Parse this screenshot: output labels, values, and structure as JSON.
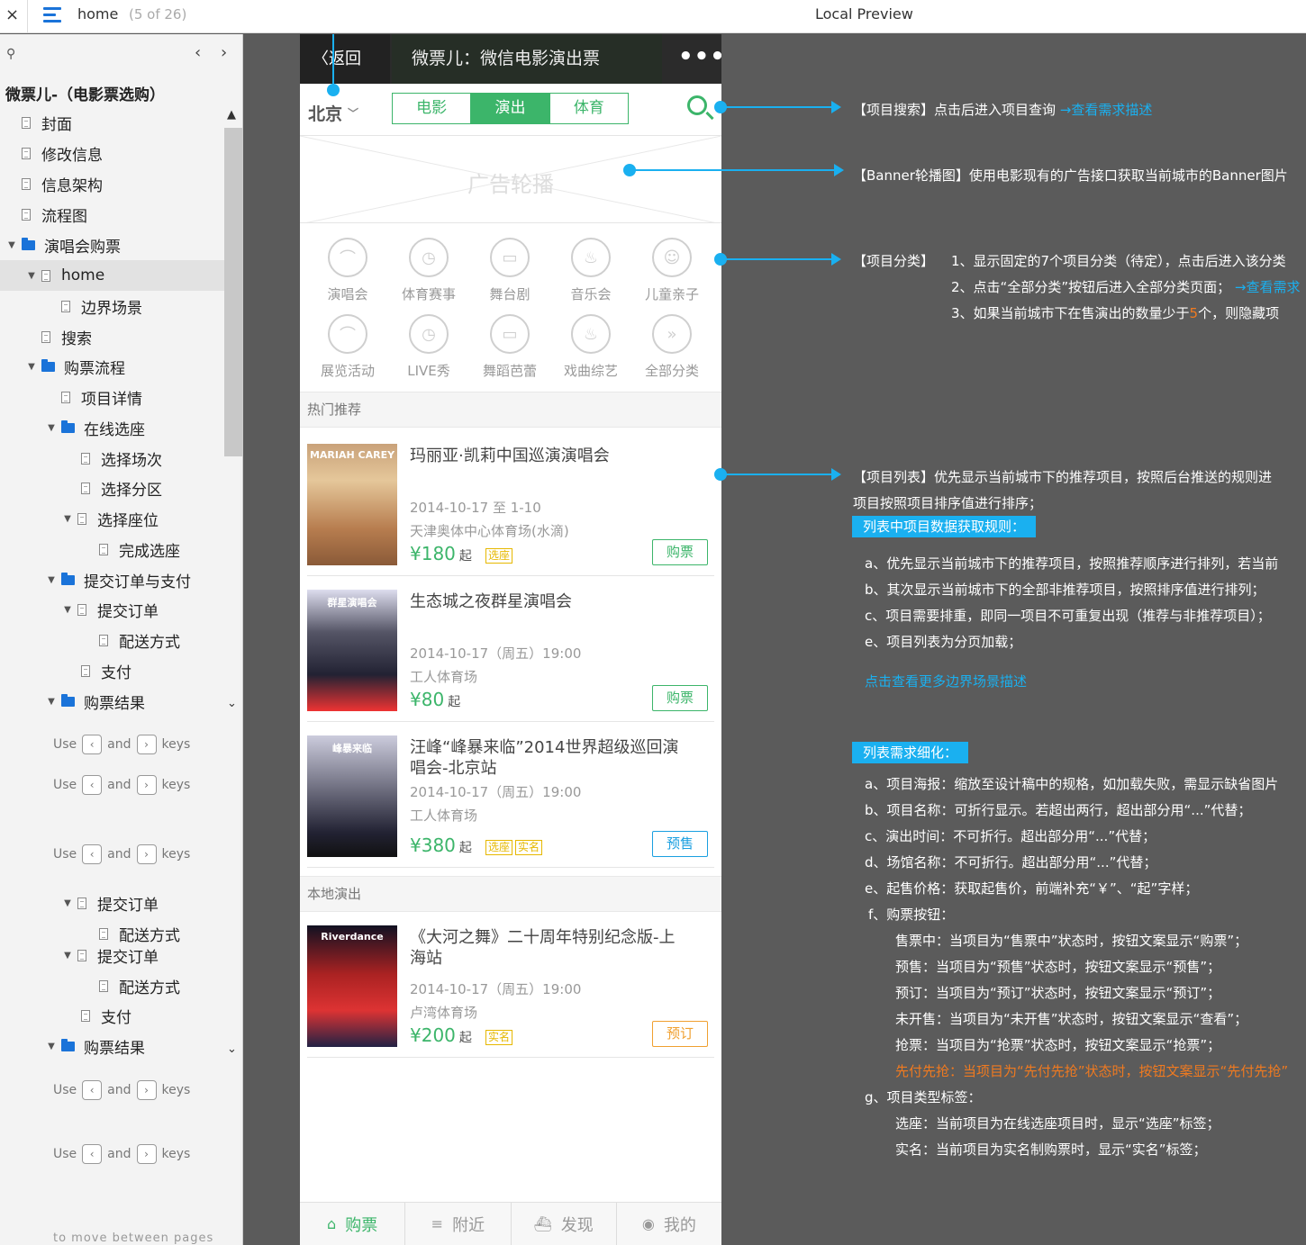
{
  "topbar": {
    "close": "×",
    "page": "home",
    "count": "(5 of 26)",
    "title": "Local Preview"
  },
  "sidebar": {
    "search_icon": "⚲",
    "prev": "‹",
    "next": "›",
    "root": "微票儿-（电影票选购）",
    "items": [
      {
        "label": "封面"
      },
      {
        "label": "修改信息"
      },
      {
        "label": "信息架构"
      },
      {
        "label": "流程图"
      },
      {
        "label": "演唱会购票"
      },
      {
        "label": "home"
      },
      {
        "label": "边界场景"
      },
      {
        "label": "搜索"
      },
      {
        "label": "购票流程"
      },
      {
        "label": "项目详情"
      },
      {
        "label": "在线选座"
      },
      {
        "label": "选择场次"
      },
      {
        "label": "选择分区"
      },
      {
        "label": "选择座位"
      },
      {
        "label": "完成选座"
      },
      {
        "label": "提交订单与支付"
      },
      {
        "label": "提交订单"
      },
      {
        "label": "配送方式"
      },
      {
        "label": "支付"
      },
      {
        "label": "购票结果"
      },
      {
        "label": "提交订单"
      },
      {
        "label": "配送方式"
      },
      {
        "label": "提交订单"
      },
      {
        "label": "配送方式"
      },
      {
        "label": "支付"
      },
      {
        "label": "购票结果"
      }
    ],
    "hint": {
      "use": "Use",
      "and": "and",
      "keys": "keys",
      "left": "‹",
      "right": "›"
    },
    "ghost_hint": "to move between pages"
  },
  "phone": {
    "back": "〈返回",
    "title": "微票儿：微信电影演出票",
    "more": "•••",
    "city": "北京",
    "tabs": [
      {
        "label": "电影"
      },
      {
        "label": "演出"
      },
      {
        "label": "体育"
      }
    ],
    "banner": "广告轮播",
    "categories": [
      {
        "label": "演唱会",
        "icon": "headphones-icon"
      },
      {
        "label": "体育赛事",
        "icon": "alarm-icon"
      },
      {
        "label": "舞台剧",
        "icon": "bus-icon"
      },
      {
        "label": "音乐会",
        "icon": "cup-icon"
      },
      {
        "label": "儿童亲子",
        "icon": "smile-icon"
      },
      {
        "label": "展览活动",
        "icon": "headphones-icon"
      },
      {
        "label": "LIVE秀",
        "icon": "alarm-icon"
      },
      {
        "label": "舞蹈芭蕾",
        "icon": "bus-icon"
      },
      {
        "label": "戏曲综艺",
        "icon": "cup-icon"
      },
      {
        "label": "全部分类",
        "icon": "double-chevron-icon"
      }
    ],
    "section_hot": "热门推荐",
    "section_local": "本地演出",
    "items": [
      {
        "name": "玛丽亚·凯莉中国巡演演唱会",
        "date": "2014-10-17 至 1-10",
        "venue": "天津奥体中心体育场(水滴)",
        "price": "¥180",
        "qi": "起",
        "tags": [
          "选座"
        ],
        "button": "购票",
        "poster_text": "MARIAH CAREY"
      },
      {
        "name": "生态城之夜群星演唱会",
        "date": "2014-10-17（周五）19:00",
        "venue": "工人体育场",
        "price": "¥80",
        "qi": "起",
        "tags": [],
        "button": "购票",
        "poster_text": "群星演唱会"
      },
      {
        "name": "汪峰“峰暴来临”2014世界超级巡回演唱会-北京站",
        "date": "2014-10-17（周五）19:00",
        "venue": "工人体育场",
        "price": "¥380",
        "qi": "起",
        "tags": [
          "选座",
          "实名"
        ],
        "button": "预售",
        "poster_text": "峰暴来临"
      },
      {
        "name": "《大河之舞》二十周年特别纪念版-上海站",
        "date": "2014-10-17（周五）19:00",
        "venue": "卢湾体育场",
        "price": "¥200",
        "qi": "起",
        "tags": [
          "实名"
        ],
        "button": "预订",
        "poster_text": "Riverdance"
      }
    ],
    "tabbar": [
      {
        "label": "购票",
        "icon": "home-icon"
      },
      {
        "label": "附近",
        "icon": "list-icon"
      },
      {
        "label": "发现",
        "icon": "ship-icon"
      },
      {
        "label": "我的",
        "icon": "user-icon"
      }
    ]
  },
  "annotations": {
    "search": {
      "text": "【项目搜索】点击后进入项目查询",
      "link": "→查看需求描述"
    },
    "banner": "【Banner轮播图】使用电影现有的广告接口获取当前城市的Banner图片",
    "category": {
      "head": "【项目分类】",
      "l1": "1、显示固定的7个项目分类（待定），点击后进入该分类",
      "l2": "2、点击“全部分类”按钮后进入全部分类页面；",
      "l2link": "→查看需求",
      "l3a": "3、如果当前城市下在售演出的数量少于",
      "l3num": "5",
      "l3b": "个，则隐藏项"
    },
    "list": {
      "l1": "【项目列表】优先显示当前城市下的推荐项目，按照后台推送的规则进",
      "l2": "项目按照项目排序值进行排序；",
      "badge1": "列表中项目数据获取规则：",
      "ra": "a、优先显示当前城市下的推荐项目，按照推荐顺序进行排列，若当前",
      "rb": "b、其次显示当前城市下的全部非推荐项目，按照排序值进行排列；",
      "rc": "c、项目需要排重，即同一项目不可重复出现（推荐与非推荐项目）；",
      "re": "e、项目列表为分页加载；",
      "more": "点击查看更多边界场景描述",
      "badge2": "列表需求细化：",
      "da": "a、项目海报：缩放至设计稿中的规格，如加载失败，需显示缺省图片",
      "db": "b、项目名称：可折行显示。若超出两行，超出部分用“...”代替；",
      "dc": "c、演出时间：不可折行。超出部分用“...”代替；",
      "dd": "d、场馆名称：不可折行。超出部分用“...”代替；",
      "de": "e、起售价格：获取起售价，前端补充“￥”、“起”字样；",
      "df": "f、购票按钮：",
      "f1": "售票中：当项目为“售票中”状态时，按钮文案显示“购票”；",
      "f2": "预售：当项目为“预售”状态时，按钮文案显示“预售”；",
      "f3": "预订：当项目为“预订”状态时，按钮文案显示“预订”；",
      "f4": "未开售：当项目为“未开售”状态时，按钮文案显示“查看”；",
      "f5": "抢票：当项目为“抢票”状态时，按钮文案显示“抢票”；",
      "f6": "先付先抢：当项目为“先付先抢”状态时，按钮文案显示“先付先抢”",
      "dg": "g、项目类型标签：",
      "g1": "选座：当前项目为在线选座项目时，显示“选座”标签；",
      "g2": "实名：当前项目为实名制购票时，显示“实名”标签；"
    }
  },
  "colors": {
    "accent_green": "#3cb56a",
    "annotation_blue": "#1ab0f0",
    "canvas": "#5b5b5b"
  }
}
